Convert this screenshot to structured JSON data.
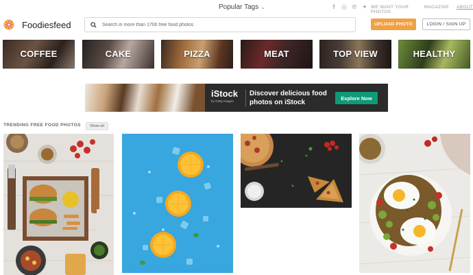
{
  "header": {
    "popular_tags": "Popular Tags",
    "social_icons": [
      "facebook-icon",
      "instagram-icon",
      "pinterest-icon",
      "twitter-icon"
    ],
    "links": [
      "WE WANT YOUR PHOTOS",
      "MAGAZINE",
      "ABOUT"
    ]
  },
  "brand": {
    "name": "Foodiesfeed"
  },
  "search": {
    "placeholder": "Search in more than 1700 free food photos",
    "value": ""
  },
  "actions": {
    "upload": "UPLOAD PHOTO",
    "login": "LOGIN / SIGN UP"
  },
  "categories": [
    "COFFEE",
    "CAKE",
    "PIZZA",
    "MEAT",
    "TOP VIEW",
    "HEALTHY"
  ],
  "banner": {
    "brand": "iStock",
    "sub": "by Getty Images",
    "headline": "Discover delicious food photos on iStock",
    "cta": "Explore Now"
  },
  "trending": {
    "title": "TRENDING FREE FOOD PHOTOS",
    "show_all": "Show all"
  },
  "colors": {
    "upload_button": "#f0a045",
    "cta_button": "#0f9a78",
    "photo_blue": "#3ea8e0"
  }
}
